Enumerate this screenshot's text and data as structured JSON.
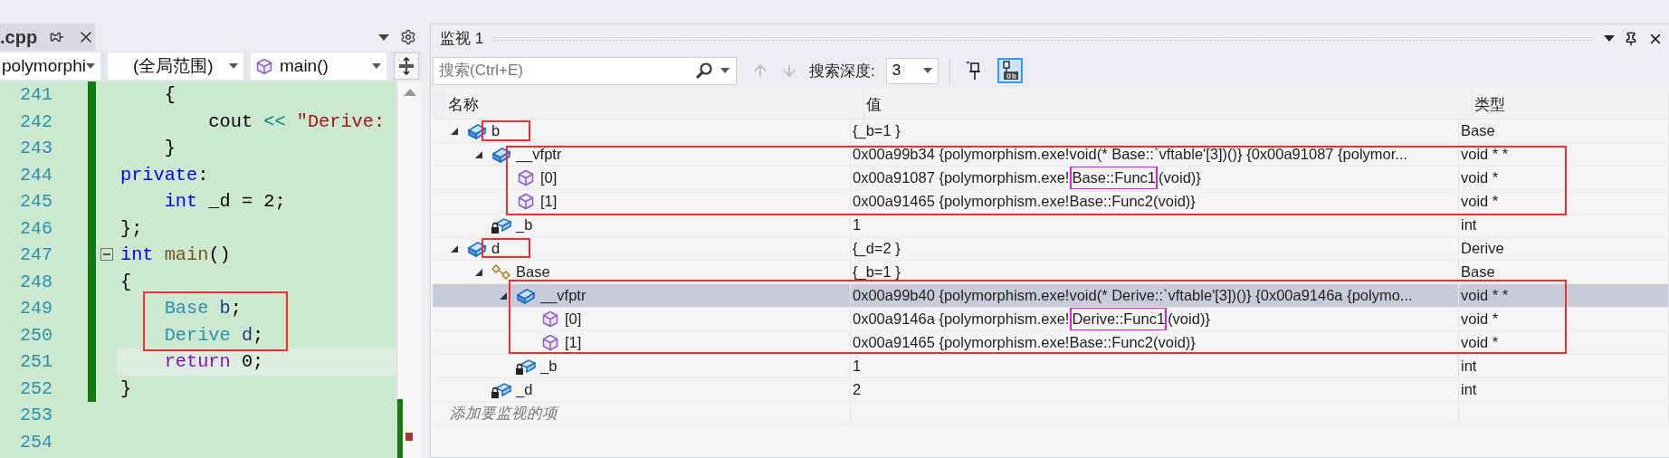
{
  "editor": {
    "tab": {
      "title": ".cpp"
    },
    "nav": {
      "project": "polymorphi",
      "scope": "(全局范围)",
      "function": "main()"
    },
    "lines": [
      {
        "number": "241",
        "changed": true,
        "fold": false,
        "current": false,
        "tokens": [
          {
            "kind": "plain",
            "text": "    {"
          }
        ]
      },
      {
        "number": "242",
        "changed": true,
        "fold": false,
        "current": false,
        "tokens": [
          {
            "kind": "plain",
            "text": "        cout "
          },
          {
            "kind": "op",
            "text": "<< "
          },
          {
            "kind": "string",
            "text": "\"Derive:"
          }
        ]
      },
      {
        "number": "243",
        "changed": true,
        "fold": false,
        "current": false,
        "tokens": [
          {
            "kind": "plain",
            "text": "    }"
          }
        ]
      },
      {
        "number": "244",
        "changed": true,
        "fold": false,
        "current": false,
        "tokens": [
          {
            "kind": "keyword",
            "text": "private"
          },
          {
            "kind": "plain",
            "text": ":"
          }
        ]
      },
      {
        "number": "245",
        "changed": true,
        "fold": false,
        "current": false,
        "tokens": [
          {
            "kind": "keyword",
            "text": "    int"
          },
          {
            "kind": "plain",
            "text": " _d = 2;"
          }
        ]
      },
      {
        "number": "246",
        "changed": true,
        "fold": false,
        "current": false,
        "tokens": [
          {
            "kind": "plain",
            "text": "};"
          }
        ]
      },
      {
        "number": "247",
        "changed": true,
        "fold": true,
        "current": false,
        "tokens": [
          {
            "kind": "keyword",
            "text": "int "
          },
          {
            "kind": "function",
            "text": "main"
          },
          {
            "kind": "plain",
            "text": "()"
          }
        ]
      },
      {
        "number": "248",
        "changed": true,
        "fold": false,
        "current": false,
        "tokens": [
          {
            "kind": "plain",
            "text": "{"
          }
        ]
      },
      {
        "number": "249",
        "changed": true,
        "fold": false,
        "current": false,
        "tokens": [
          {
            "kind": "type",
            "text": "    Base "
          },
          {
            "kind": "local",
            "text": "b"
          },
          {
            "kind": "plain",
            "text": ";"
          }
        ]
      },
      {
        "number": "250",
        "changed": true,
        "fold": false,
        "current": false,
        "tokens": [
          {
            "kind": "type",
            "text": "    Derive "
          },
          {
            "kind": "local",
            "text": "d"
          },
          {
            "kind": "plain",
            "text": ";"
          }
        ]
      },
      {
        "number": "251",
        "changed": true,
        "fold": false,
        "current": true,
        "tokens": [
          {
            "kind": "control",
            "text": "    return"
          },
          {
            "kind": "plain",
            "text": " 0;"
          }
        ]
      },
      {
        "number": "252",
        "changed": true,
        "fold": false,
        "current": false,
        "tokens": [
          {
            "kind": "plain",
            "text": "}"
          }
        ]
      },
      {
        "number": "253",
        "changed": false,
        "fold": false,
        "current": false
      },
      {
        "number": "254",
        "changed": false,
        "fold": false,
        "current": false
      }
    ]
  },
  "watch": {
    "title": "监视 1",
    "search": {
      "placeholder": "搜索(Ctrl+E)"
    },
    "depth_label": "搜索深度:",
    "depth": "3",
    "toggles": [
      {
        "kind": "pin",
        "selected": false
      },
      {
        "kind": "text",
        "selected": true
      }
    ],
    "columns": [
      "名称",
      "值",
      "类型"
    ],
    "rows": [
      {
        "name": "b",
        "kind": "object",
        "expanded": true,
        "selected": false,
        "value": "{_b=1 }",
        "type": "Base",
        "children": [
          {
            "name": "__vfptr",
            "kind": "object",
            "expanded": true,
            "selected": false,
            "value": "0x00a99b34 {polymorphism.exe!void(* Base::`vftable'[3])()} {0x00a91087 {polymor...",
            "type": "void * *",
            "children": [
              {
                "name": "[0]",
                "kind": "member",
                "selected": false,
                "value_parts": [
                  {
                    "text": "0x00a91087 {polymorphism.exe!",
                    "boxed": false
                  },
                  {
                    "text": "Base::Func1",
                    "boxed": true
                  },
                  {
                    "text": "(void)}",
                    "boxed": false
                  }
                ],
                "type": "void *"
              },
              {
                "name": "[1]",
                "kind": "member",
                "selected": false,
                "value": "0x00a91465 {polymorphism.exe!Base::Func2(void)}",
                "type": "void *"
              }
            ]
          },
          {
            "name": "_b",
            "kind": "private",
            "selected": false,
            "value": "1",
            "type": "int"
          }
        ]
      },
      {
        "name": "d",
        "kind": "object",
        "expanded": true,
        "selected": false,
        "value": "{_d=2 }",
        "type": "Derive",
        "children": [
          {
            "name": "Base",
            "kind": "base",
            "expanded": true,
            "selected": false,
            "value": "{_b=1 }",
            "type": "Base",
            "children": [
              {
                "name": "__vfptr",
                "kind": "object",
                "expanded": true,
                "selected": true,
                "value": "0x00a99b40 {polymorphism.exe!void(* Derive::`vftable'[3])()} {0x00a9146a {polymo...",
                "type": "void * *",
                "children": [
                  {
                    "name": "[0]",
                    "kind": "member",
                    "selected": false,
                    "value_parts": [
                      {
                        "text": "0x00a9146a {polymorphism.exe!",
                        "boxed": false
                      },
                      {
                        "text": "Derive::Func1",
                        "boxed": true
                      },
                      {
                        "text": "(void)}",
                        "boxed": false
                      }
                    ],
                    "type": "void *"
                  },
                  {
                    "name": "[1]",
                    "kind": "member",
                    "selected": false,
                    "value": "0x00a91465 {polymorphism.exe!Base::Func2(void)}",
                    "type": "void *"
                  }
                ]
              },
              {
                "name": "_b",
                "kind": "private",
                "selected": false,
                "value": "1",
                "type": "int"
              }
            ]
          },
          {
            "name": "_d",
            "kind": "private",
            "selected": false,
            "value": "2",
            "type": "int"
          }
        ]
      }
    ],
    "add_placeholder": "添加要监视的项"
  }
}
